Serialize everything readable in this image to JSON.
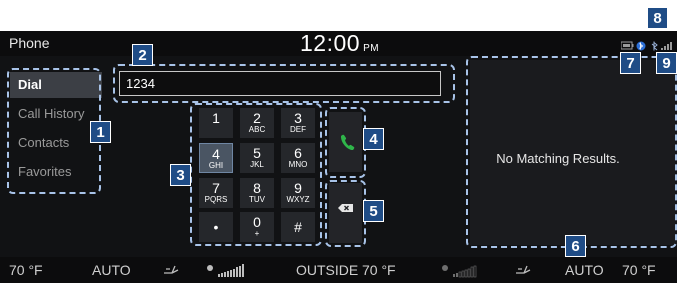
{
  "header": {
    "app_title": "Phone",
    "time": "12:00",
    "ampm": "PM"
  },
  "status_icons": [
    "battery-icon",
    "bluetooth-audio-icon",
    "bluetooth-icon",
    "signal-icon"
  ],
  "sidebar": {
    "items": [
      {
        "label": "Dial",
        "active": true
      },
      {
        "label": "Call History",
        "active": false
      },
      {
        "label": "Contacts",
        "active": false
      },
      {
        "label": "Favorites",
        "active": false
      }
    ]
  },
  "dial": {
    "value": "1234"
  },
  "keypad": {
    "keys": [
      {
        "digit": "1",
        "letters": ""
      },
      {
        "digit": "2",
        "letters": "ABC"
      },
      {
        "digit": "3",
        "letters": "DEF"
      },
      {
        "digit": "4",
        "letters": "GHI",
        "selected": true
      },
      {
        "digit": "5",
        "letters": "JKL"
      },
      {
        "digit": "6",
        "letters": "MNO"
      },
      {
        "digit": "7",
        "letters": "PQRS"
      },
      {
        "digit": "8",
        "letters": "TUV"
      },
      {
        "digit": "9",
        "letters": "WXYZ"
      },
      {
        "digit": "•",
        "letters": ""
      },
      {
        "digit": "0",
        "letters": "+"
      },
      {
        "digit": "#",
        "letters": ""
      }
    ]
  },
  "actions": {
    "call_icon": "phone-icon",
    "delete_icon": "backspace-icon"
  },
  "results": {
    "message": "No Matching Results."
  },
  "climate": {
    "left_temp": "70 °F",
    "left_mode": "AUTO",
    "outside_label": "OUTSIDE",
    "outside_temp": "70 °F",
    "right_mode": "AUTO",
    "right_temp": "70 °F"
  },
  "callouts": [
    "1",
    "2",
    "3",
    "4",
    "5",
    "6",
    "7",
    "8",
    "9"
  ],
  "colors": {
    "callout_bg": "#1f4c86",
    "dash": "#a8c3e8",
    "call_green": "#2fb54a"
  }
}
